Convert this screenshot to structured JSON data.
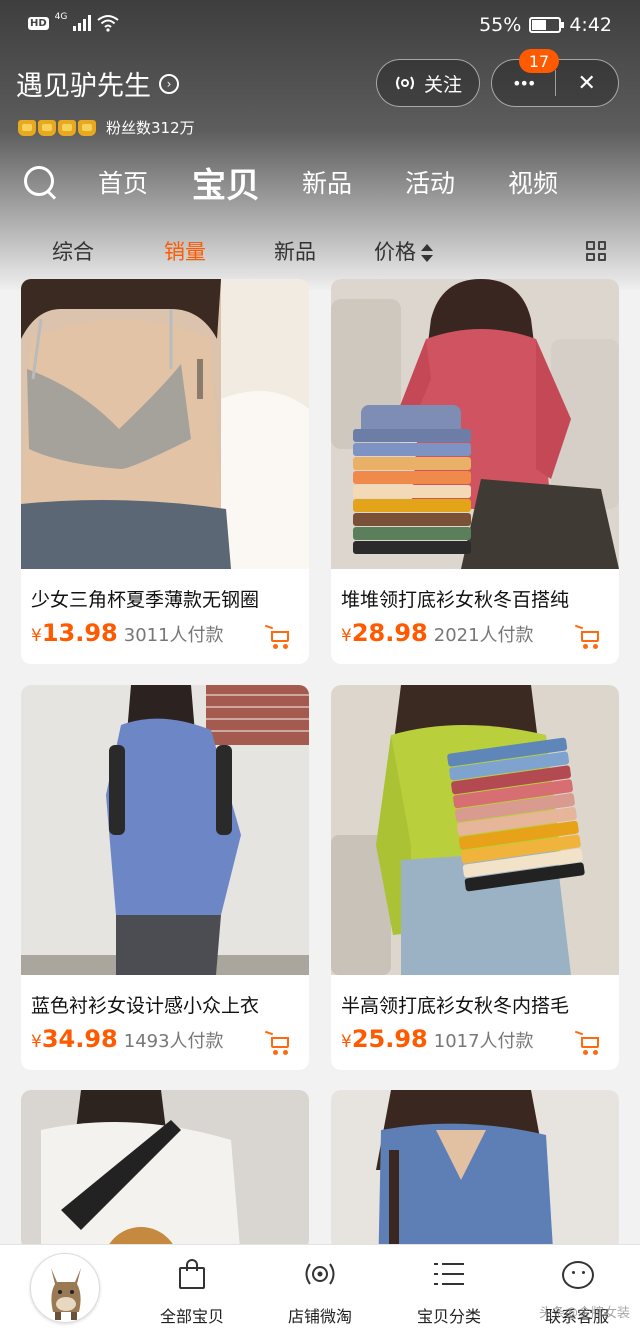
{
  "status_bar": {
    "hd": "HD",
    "network": "4G",
    "battery": "55%",
    "battery_level": 0.55,
    "time": "4:42"
  },
  "shop": {
    "name": "遇见驴先生",
    "fans": "粉丝数312万",
    "follow_label": "关注",
    "more_label": "•••",
    "notification_count": "17",
    "close_label": "✕"
  },
  "nav": {
    "tabs": [
      "首页",
      "宝贝",
      "新品",
      "活动",
      "视频"
    ],
    "active": "宝贝"
  },
  "sort": {
    "items": [
      "综合",
      "销量",
      "新品",
      "价格"
    ],
    "active": "销量"
  },
  "products": [
    {
      "title": "少女三角杯夏季薄款无钢圈",
      "currency": "¥",
      "price": "13.98",
      "sold": "3011人付款"
    },
    {
      "title": "堆堆领打底衫女秋冬百搭纯",
      "currency": "¥",
      "price": "28.98",
      "sold": "2021人付款"
    },
    {
      "title": "蓝色衬衫女设计感小众上衣",
      "currency": "¥",
      "price": "34.98",
      "sold": "1493人付款"
    },
    {
      "title": "半高领打底衫女秋冬内搭毛",
      "currency": "¥",
      "price": "25.98",
      "sold": "1017人付款"
    }
  ],
  "bottom_tabs": {
    "all_items": "全部宝贝",
    "shop_live": "店铺微淘",
    "categories": "宝贝分类",
    "customer_service": "联系客服"
  },
  "watermark": "头条@金牌女装",
  "colors": {
    "accent": "#ff5a00",
    "header_dark": "#3e3e3e"
  }
}
